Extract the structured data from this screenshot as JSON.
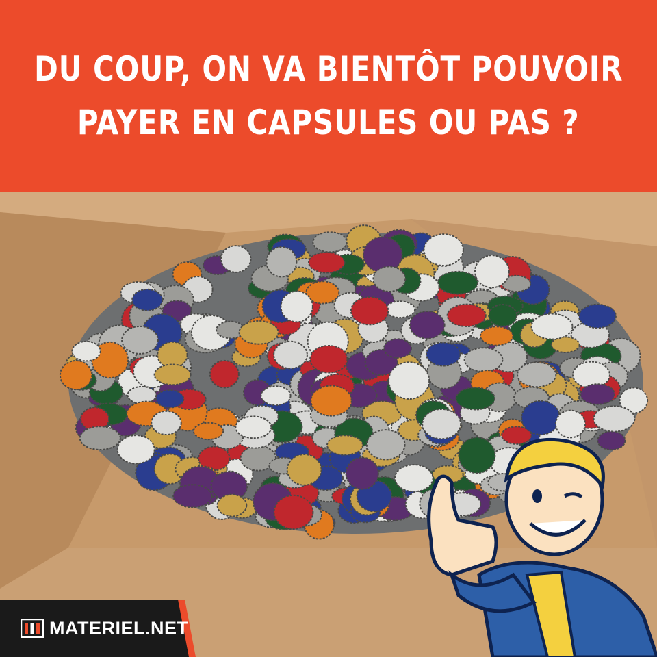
{
  "headline": {
    "line1": "DU COUP, ON VA BIENTÔT POUVOIR",
    "line2": "PAYER EN CAPSULES OU PAS ?"
  },
  "brand": {
    "name": "MATERIEL.NET",
    "logo_icon": "shop-front-icon"
  },
  "colors": {
    "banner": "#ec4b2b",
    "cardboard": "#c89a6a",
    "brand_bar": "#1a1a1a",
    "brand_accent": "#ec4b2b"
  },
  "photo": {
    "subject": "box-of-bottle-caps",
    "mascot": "vault-boy-thumbs-up"
  }
}
